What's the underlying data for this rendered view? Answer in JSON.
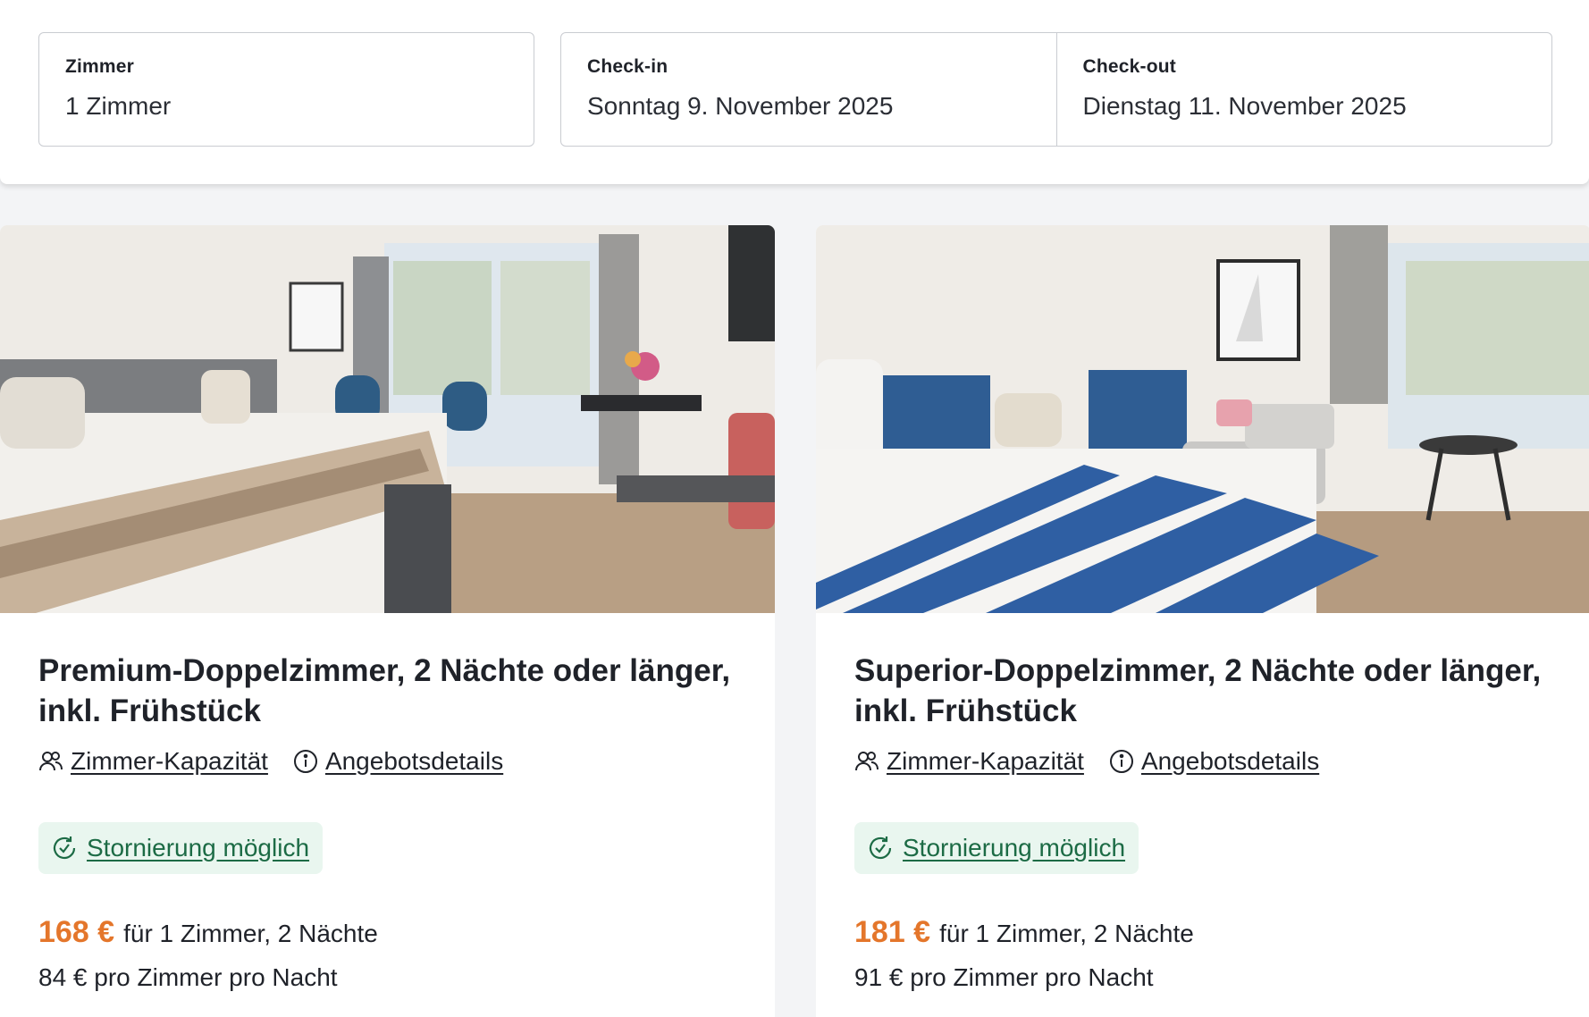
{
  "search": {
    "rooms_label": "Zimmer",
    "rooms_value": "1 Zimmer",
    "checkin_label": "Check-in",
    "checkin_value": "Sonntag 9. November 2025",
    "checkout_label": "Check-out",
    "checkout_value": "Dienstag 11. November 2025"
  },
  "offers": [
    {
      "title": "Premium-Doppelzimmer, 2 Nächte oder länger, inkl. Frühstück",
      "capacity_link": "Zimmer-Kapazität",
      "details_link": "Angebotsdetails",
      "cancellation": "Stornierung möglich",
      "price": "168 €",
      "price_desc": "für 1 Zimmer, 2 Nächte",
      "per_night": "84 € pro Zimmer pro Nacht"
    },
    {
      "title": "Superior-Doppelzimmer, 2 Nächte oder länger, inkl. Frühstück",
      "capacity_link": "Zimmer-Kapazität",
      "details_link": "Angebotsdetails",
      "cancellation": "Stornierung möglich",
      "price": "181 €",
      "price_desc": "für 1 Zimmer, 2 Nächte",
      "per_night": "91 € pro Zimmer pro Nacht"
    }
  ],
  "colors": {
    "price": "#e4762b",
    "cancel_bg": "#e9f6ef",
    "cancel_text": "#1c6b45",
    "border": "#c9ccd1"
  },
  "icons": {
    "capacity": "users-icon",
    "details": "info-icon",
    "cancellation": "refresh-check-icon"
  }
}
